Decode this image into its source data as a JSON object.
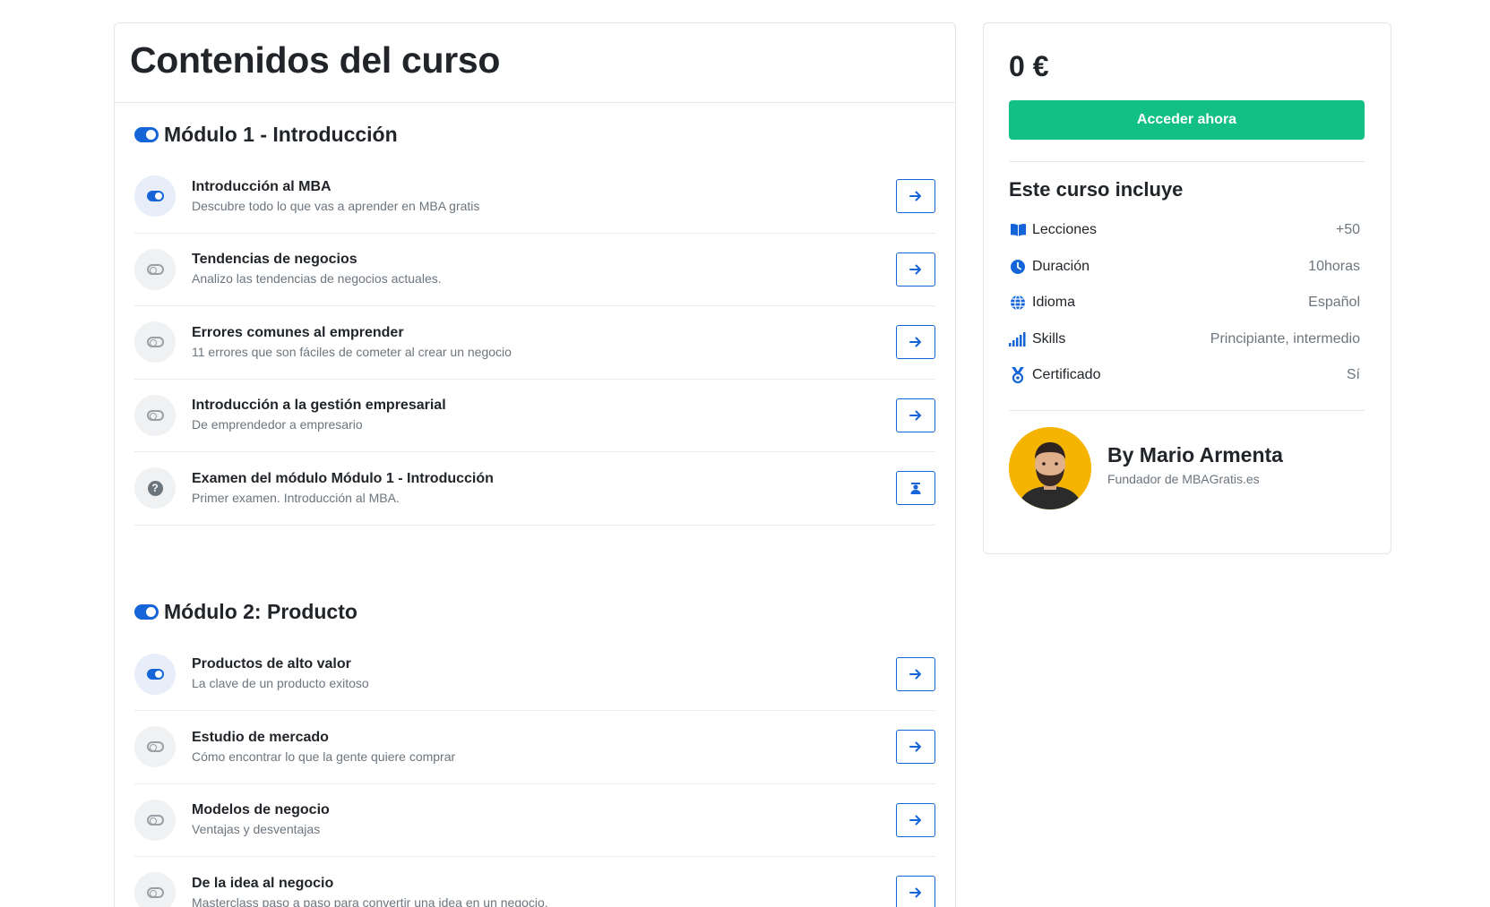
{
  "main": {
    "title": "Contenidos del curso",
    "modules": [
      {
        "title": "Módulo 1 - Introducción",
        "lessons": [
          {
            "title": "Introducción al MBA",
            "subtitle": "Descubre todo lo que vas a aprender en MBA gratis",
            "icon": "toggle-on-icon",
            "action_icon": "arrow-right-icon"
          },
          {
            "title": "Tendencias de negocios",
            "subtitle": "Analizo las tendencias de negocios actuales.",
            "icon": "toggle-off-icon",
            "action_icon": "arrow-right-icon"
          },
          {
            "title": "Errores comunes al emprender",
            "subtitle": "11 errores que son fáciles de cometer al crear un negocio",
            "icon": "toggle-off-icon",
            "action_icon": "arrow-right-icon"
          },
          {
            "title": "Introducción a la gestión empresarial",
            "subtitle": "De emprendedor a empresario",
            "icon": "toggle-off-icon",
            "action_icon": "arrow-right-icon"
          },
          {
            "title": "Examen del módulo Módulo 1 - Introducción",
            "subtitle": "Primer examen. Introducción al MBA.",
            "icon": "question-circle-icon",
            "action_icon": "graduate-icon"
          }
        ]
      },
      {
        "title": "Módulo 2: Producto",
        "lessons": [
          {
            "title": "Productos de alto valor",
            "subtitle": "La clave de un producto exitoso",
            "icon": "toggle-on-icon",
            "action_icon": "arrow-right-icon"
          },
          {
            "title": "Estudio de mercado",
            "subtitle": "Cómo encontrar lo que la gente quiere comprar",
            "icon": "toggle-off-icon",
            "action_icon": "arrow-right-icon"
          },
          {
            "title": "Modelos de negocio",
            "subtitle": "Ventajas y desventajas",
            "icon": "toggle-off-icon",
            "action_icon": "arrow-right-icon"
          },
          {
            "title": "De la idea al negocio",
            "subtitle": "Masterclass paso a paso para convertir una idea en un negocio.",
            "icon": "toggle-off-icon",
            "action_icon": "arrow-right-icon"
          }
        ]
      }
    ]
  },
  "sidebar": {
    "price": "0 €",
    "cta_label": "Acceder ahora",
    "includes_title": "Este curso incluye",
    "includes": [
      {
        "label": "Lecciones",
        "value": "+50",
        "icon": "book-icon"
      },
      {
        "label": "Duración",
        "value": "10horas",
        "icon": "clock-icon"
      },
      {
        "label": "Idioma",
        "value": "Español",
        "icon": "globe-icon"
      },
      {
        "label": "Skills",
        "value": "Principiante, intermedio",
        "icon": "signal-bars-icon"
      },
      {
        "label": "Certificado",
        "value": "Sí",
        "icon": "medal-icon"
      }
    ],
    "author": {
      "name": "By Mario Armenta",
      "role": "Fundador de MBAGratis.es"
    }
  },
  "colors": {
    "accent": "#1565d8",
    "cta": "#12bf85",
    "avatar_bg": "#f5b400"
  }
}
